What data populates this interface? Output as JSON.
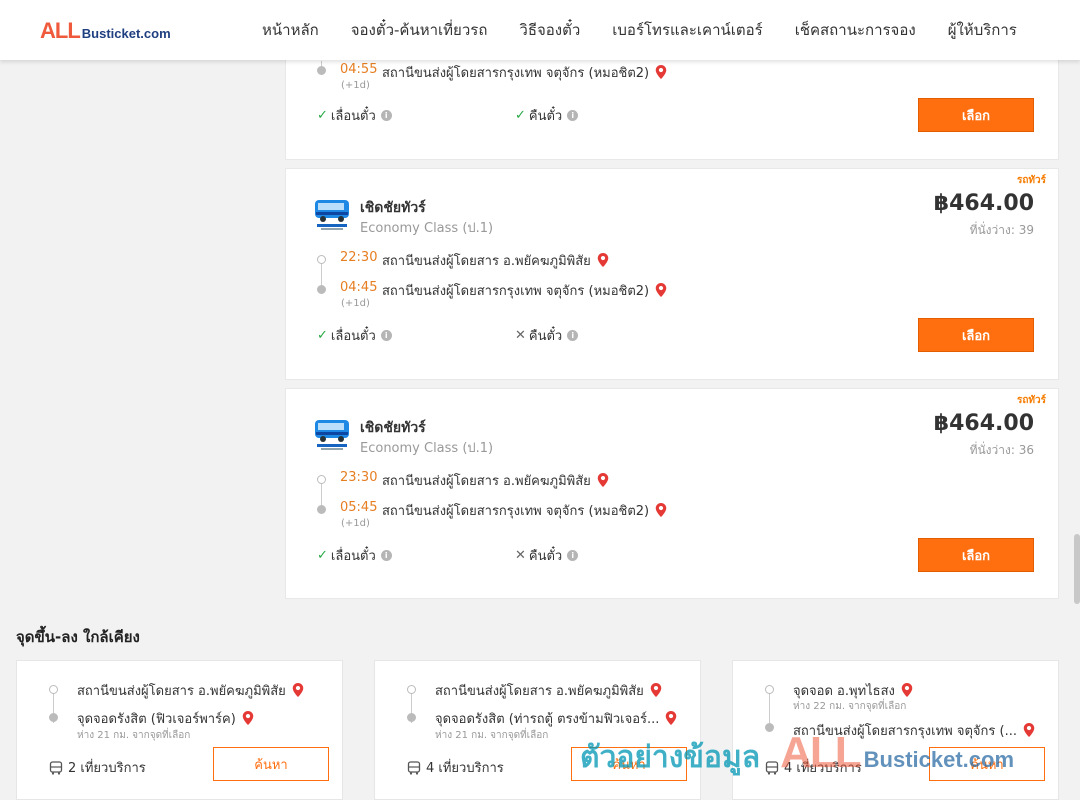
{
  "brand": {
    "logo_all": "ALL",
    "logo_rest": "Busticket.com"
  },
  "nav": [
    "หน้าหลัก",
    "จองตั๋ว-ค้นหาเที่ยวรถ",
    "วิธีจองตั๋ว",
    "เบอร์โทรและเคาน์เตอร์",
    "เช็คสถานะการจอง",
    "ผู้ให้บริการ"
  ],
  "partial_card": {
    "arr_time": "04:55",
    "arr_station": "สถานีขนส่งผู้โดยสารกรุงเทพ จตุจักร (หมอชิต2)",
    "plus_day": "(+1d)",
    "change_label": "เลื่อนตั๋ว",
    "refund_label": "คืนตั๋ว",
    "select_label": "เลือก"
  },
  "trips": [
    {
      "badge": "รถทัวร์",
      "operator": "เชิดชัยทัวร์",
      "class": "Economy Class (ป.1)",
      "price": "฿464.00",
      "seats": "ที่นั่งว่าง: 39",
      "dep_time": "22:30",
      "dep_station": "สถานีขนส่งผู้โดยสาร อ.พยัคฆภูมิพิสัย",
      "arr_time": "04:45",
      "arr_station": "สถานีขนส่งผู้โดยสารกรุงเทพ จตุจักร (หมอชิต2)",
      "plus_day": "(+1d)",
      "change_label": "เลื่อนตั๋ว",
      "refund_label": "คืนตั๋ว",
      "select_label": "เลือก"
    },
    {
      "badge": "รถทัวร์",
      "operator": "เชิดชัยทัวร์",
      "class": "Economy Class (ป.1)",
      "price": "฿464.00",
      "seats": "ที่นั่งว่าง: 36",
      "dep_time": "23:30",
      "dep_station": "สถานีขนส่งผู้โดยสาร อ.พยัคฆภูมิพิสัย",
      "arr_time": "05:45",
      "arr_station": "สถานีขนส่งผู้โดยสารกรุงเทพ จตุจักร (หมอชิต2)",
      "plus_day": "(+1d)",
      "change_label": "เลื่อนตั๋ว",
      "refund_label": "คืนตั๋ว",
      "select_label": "เลือก"
    }
  ],
  "nearby": {
    "title": "จุดขึ้น-ลง ใกล้เคียง",
    "cards": [
      {
        "from": "สถานีขนส่งผู้โดยสาร อ.พยัคฆภูมิพิสัย",
        "to": "จุดจอดรังสิต (ฟิวเจอร์พาร์ค)",
        "distance": "ห่าง 21 กม. จากจุดที่เลือก",
        "trips": "2 เที่ยวบริการ",
        "search_label": "ค้นหา"
      },
      {
        "from": "สถานีขนส่งผู้โดยสาร อ.พยัคฆภูมิพิสัย",
        "to": "จุดจอดรังสิต (ท่ารถตู้ ตรงข้ามฟิวเจอร์...",
        "distance": "ห่าง 21 กม. จากจุดที่เลือก",
        "trips": "4 เที่ยวบริการ",
        "search_label": "ค้นหา"
      },
      {
        "from": "จุดจอด อ.พุทไธสง",
        "from_distance": "ห่าง 22 กม. จากจุดที่เลือก",
        "to": "สถานีขนส่งผู้โดยสารกรุงเทพ จตุจักร (...",
        "trips": "4 เที่ยวบริการ",
        "search_label": "ค้นหา"
      }
    ]
  },
  "watermark": {
    "thai": "ตัวอย่างข้อมูล",
    "all": "ALL",
    "rest": "Busticket.com"
  },
  "colors": {
    "accent": "#ff6f10",
    "time": "#e67e22",
    "brand_red": "#ef5a3c",
    "brand_blue": "#1f3f80"
  }
}
